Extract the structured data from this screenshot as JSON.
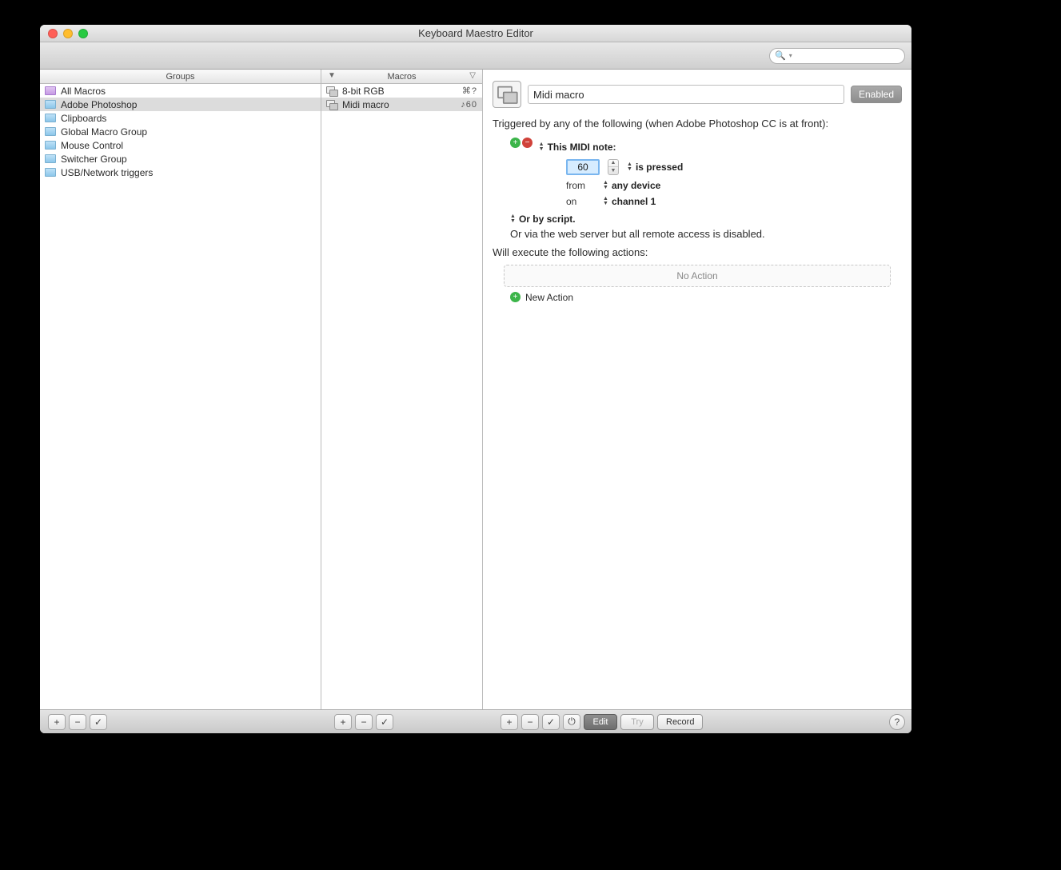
{
  "window": {
    "title": "Keyboard Maestro Editor"
  },
  "search": {
    "placeholder": ""
  },
  "columns": {
    "groups_header": "Groups",
    "macros_header": "Macros",
    "groups": [
      {
        "name": "All Macros",
        "special": true
      },
      {
        "name": "Adobe Photoshop",
        "selected": true
      },
      {
        "name": "Clipboards"
      },
      {
        "name": "Global Macro Group"
      },
      {
        "name": "Mouse Control"
      },
      {
        "name": "Switcher Group"
      },
      {
        "name": "USB/Network triggers"
      }
    ],
    "macros": [
      {
        "name": "8-bit RGB",
        "shortcut": "⌘?"
      },
      {
        "name": "Midi macro",
        "shortcut": "♪60",
        "selected": true
      }
    ]
  },
  "detail": {
    "name": "Midi macro",
    "enabled_label": "Enabled",
    "trigger_intro": "Triggered by any of the following (when Adobe Photoshop CC is at front):",
    "trigger_type": "This MIDI note:",
    "note_value": "60",
    "press_state": "is pressed",
    "from_label": "from",
    "device": "any device",
    "on_label": "on",
    "channel": "channel 1",
    "or_script": "Or by script.",
    "or_web": "Or via the web server but all remote access is disabled.",
    "exec_intro": "Will execute the following actions:",
    "no_action": "No Action",
    "new_action": "New Action"
  },
  "bottombar": {
    "edit": "Edit",
    "try": "Try",
    "record": "Record"
  }
}
